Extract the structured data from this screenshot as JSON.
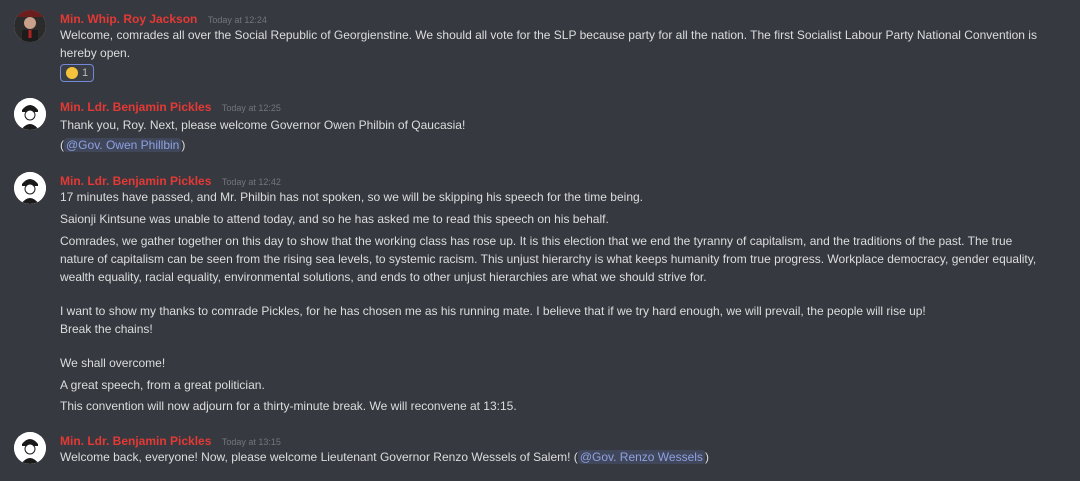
{
  "messages": [
    {
      "author": "Min. Whip. Roy Jackson",
      "timestamp": "Today at 12:24",
      "lines": [
        "Welcome, comrades all over the Social Republic of Georgienstine. We should all vote for the SLP because party for all the nation. The first Socialist Labour Party National Convention is",
        "hereby open."
      ],
      "reaction": {
        "emoji": "clapping-hands",
        "count": "1"
      }
    },
    {
      "author": "Min. Ldr. Benjamin Pickles",
      "timestamp": "Today at 12:25",
      "lines": [
        "Thank you, Roy. Next, please welcome Governor Owen Philbin of Qaucasia!"
      ],
      "mention_line": {
        "open": "(",
        "mention": "@Gov. Owen Phillbin",
        "close": ")"
      }
    },
    {
      "author": "Min. Ldr. Benjamin Pickles",
      "timestamp": "Today at 12:42",
      "lines": [
        "17 minutes have passed, and Mr. Philbin has not spoken, so we will be skipping his speech for the time being.",
        "Saionji Kintsune was unable to attend today, and so he has asked me to read this speech on his behalf.",
        "Comrades, we gather together on this day to show that the working class has rose up. It is this election that we end the tyranny of capitalism, and the traditions of the past. The true",
        "nature of capitalism can be seen from the rising sea levels, to systemic racism. This unjust hierarchy is what keeps humanity from true progress. Workplace democracy, gender equality,",
        "wealth equality, racial equality, environmental solutions, and ends to other unjust hierarchies are what we should strive for.",
        "I want to show my thanks to comrade Pickles, for he has chosen me as his running mate. I believe that if we try hard enough, we will prevail, the people will rise up!",
        "Break the chains!",
        "We shall overcome!",
        "A great speech, from a great politician.",
        "This convention will now adjourn for a thirty-minute break. We will reconvene at 13:15."
      ]
    },
    {
      "author": "Min. Ldr. Benjamin Pickles",
      "timestamp": "Today at 13:15",
      "text_before": "Welcome back, everyone! Now, please welcome Lieutenant Governor Renzo Wessels of Salem! (",
      "mention": "@Gov. Renzo Wessels",
      "text_after": ")"
    }
  ],
  "colors": {
    "background": "#36393f",
    "author": "#e53935",
    "mention": "#8ea1e1"
  }
}
